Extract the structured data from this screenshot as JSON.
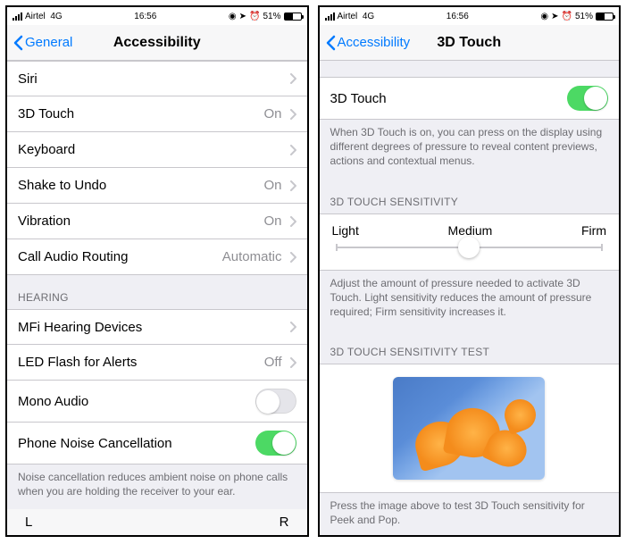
{
  "status": {
    "carrier": "Airtel",
    "network": "4G",
    "time": "16:56",
    "battery_pct": "51%"
  },
  "left": {
    "back": "General",
    "title": "Accessibility",
    "rows": {
      "siri": "Siri",
      "touch3d": "3D Touch",
      "touch3d_val": "On",
      "keyboard": "Keyboard",
      "shake": "Shake to Undo",
      "shake_val": "On",
      "vibration": "Vibration",
      "vibration_val": "On",
      "audio_route": "Call Audio Routing",
      "audio_route_val": "Automatic"
    },
    "hearing_header": "HEARING",
    "hearing": {
      "mfi": "MFi Hearing Devices",
      "led": "LED Flash for Alerts",
      "led_val": "Off",
      "mono": "Mono Audio",
      "noise": "Phone Noise Cancellation"
    },
    "noise_footer": "Noise cancellation reduces ambient noise on phone calls when you are holding the receiver to your ear.",
    "balance": {
      "l": "L",
      "r": "R"
    }
  },
  "right": {
    "back": "Accessibility",
    "title": "3D Touch",
    "row_label": "3D Touch",
    "desc": "When 3D Touch is on, you can press on the display using different degrees of pressure to reveal content previews, actions and contextual menus.",
    "sens_header": "3D TOUCH SENSITIVITY",
    "sens": {
      "light": "Light",
      "medium": "Medium",
      "firm": "Firm"
    },
    "sens_footer": "Adjust the amount of pressure needed to activate 3D Touch. Light sensitivity reduces the amount of pressure required; Firm sensitivity increases it.",
    "test_header": "3D TOUCH SENSITIVITY TEST",
    "test_footer": "Press the image above to test 3D Touch sensitivity for Peek and Pop."
  }
}
